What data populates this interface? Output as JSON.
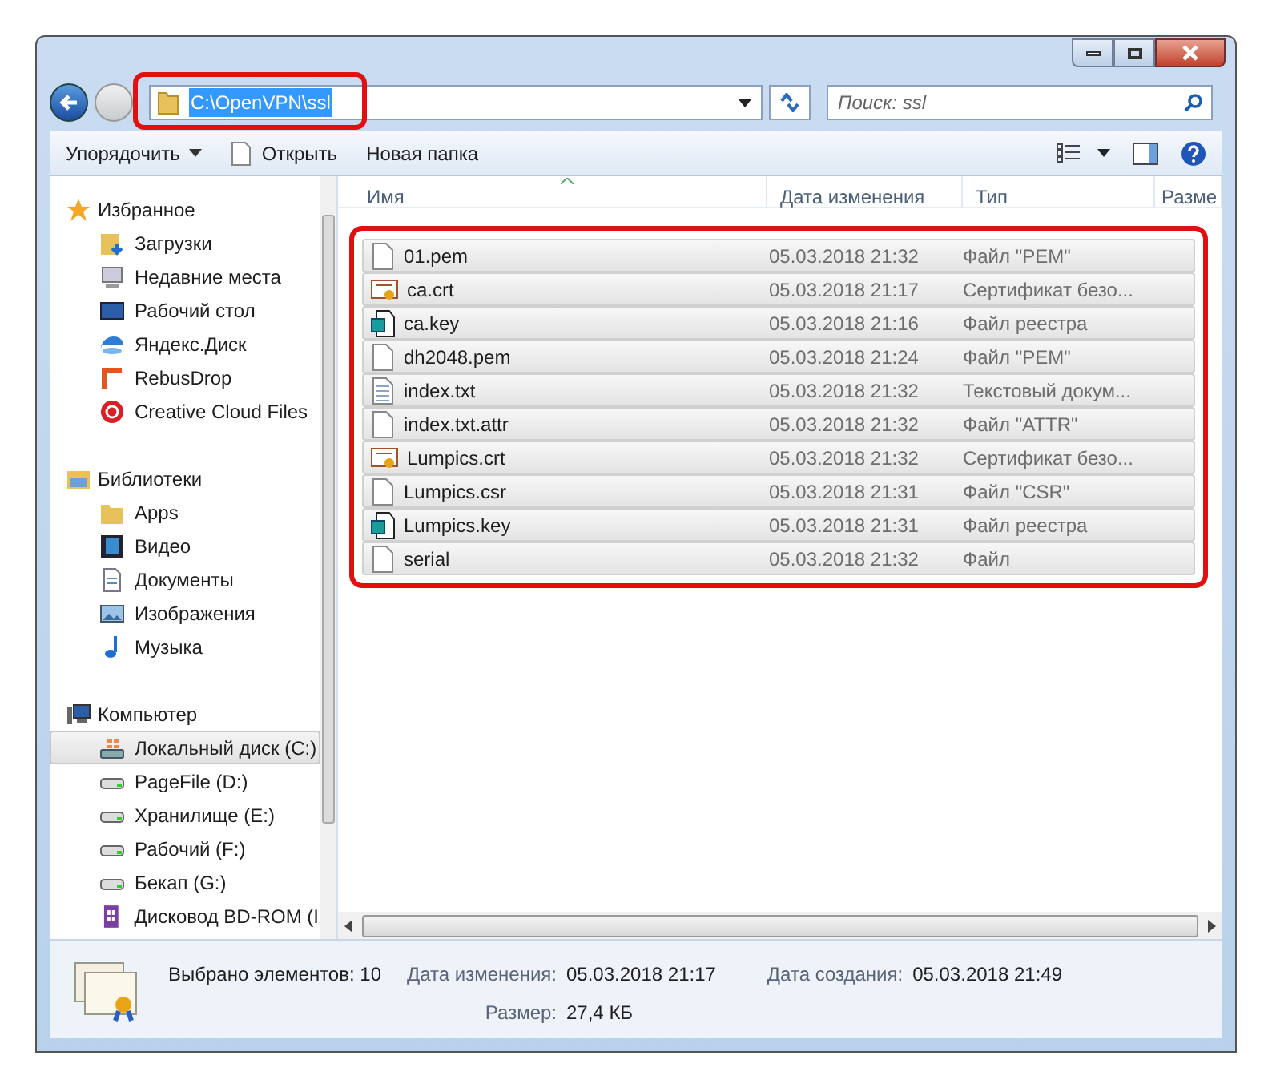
{
  "address": {
    "path": "C:\\OpenVPN\\ssl",
    "selected": true
  },
  "search": {
    "placeholder": "Поиск: ssl"
  },
  "toolbar": [
    "Упорядочить",
    "Открыть",
    "Новая папка"
  ],
  "nav": [
    {
      "label": "Избранное",
      "kind": "star",
      "children": [
        {
          "label": "Загрузки",
          "kind": "download",
          "selected": false
        },
        {
          "label": "Недавние места",
          "kind": "recent",
          "selected": false
        },
        {
          "label": "Рабочий стол",
          "kind": "desktop",
          "selected": false
        },
        {
          "label": "Яндекс.Диск",
          "kind": "cloud",
          "selected": false
        },
        {
          "label": "RebusDrop",
          "kind": "corner",
          "selected": false
        },
        {
          "label": "Creative Cloud Files",
          "kind": "cc",
          "selected": false
        }
      ]
    },
    {
      "label": "Библиотеки",
      "kind": "library",
      "children": [
        {
          "label": "Apps",
          "kind": "folder",
          "selected": false
        },
        {
          "label": "Видео",
          "kind": "film",
          "selected": false
        },
        {
          "label": "Документы",
          "kind": "doc",
          "selected": false
        },
        {
          "label": "Изображения",
          "kind": "image",
          "selected": false
        },
        {
          "label": "Музыка",
          "kind": "music",
          "selected": false
        }
      ]
    },
    {
      "label": "Компьютер",
      "kind": "computer",
      "children": [
        {
          "label": "Локальный диск (C:)",
          "kind": "sysdrive",
          "selected": true
        },
        {
          "label": "PageFile (D:)",
          "kind": "drive",
          "selected": false
        },
        {
          "label": "Хранилище (E:)",
          "kind": "drive",
          "selected": false
        },
        {
          "label": "Рабочий (F:)",
          "kind": "drive",
          "selected": false
        },
        {
          "label": "Бекап (G:)",
          "kind": "drive",
          "selected": false
        },
        {
          "label": "Дисковод BD-ROM (I",
          "kind": "optical",
          "selected": false
        }
      ]
    }
  ],
  "columns": [
    "Имя",
    "Дата изменения",
    "Тип",
    "Разме"
  ],
  "files": [
    {
      "name": "01.pem",
      "date": "05.03.2018 21:32",
      "type": "Файл \"PEM\"",
      "kind": "file",
      "selected": true
    },
    {
      "name": "ca.crt",
      "date": "05.03.2018 21:17",
      "type": "Сертификат безо...",
      "kind": "certificate",
      "selected": true
    },
    {
      "name": "ca.key",
      "date": "05.03.2018 21:16",
      "type": "Файл реестра",
      "kind": "registry",
      "selected": true
    },
    {
      "name": "dh2048.pem",
      "date": "05.03.2018 21:24",
      "type": "Файл \"PEM\"",
      "kind": "file",
      "selected": true
    },
    {
      "name": "index.txt",
      "date": "05.03.2018 21:32",
      "type": "Текстовый докум...",
      "kind": "text",
      "selected": true
    },
    {
      "name": "index.txt.attr",
      "date": "05.03.2018 21:32",
      "type": "Файл \"ATTR\"",
      "kind": "file",
      "selected": true
    },
    {
      "name": "Lumpics.crt",
      "date": "05.03.2018 21:32",
      "type": "Сертификат безо...",
      "kind": "certificate",
      "selected": true
    },
    {
      "name": "Lumpics.csr",
      "date": "05.03.2018 21:31",
      "type": "Файл \"CSR\"",
      "kind": "file",
      "selected": true
    },
    {
      "name": "Lumpics.key",
      "date": "05.03.2018 21:31",
      "type": "Файл реестра",
      "kind": "registry",
      "selected": true
    },
    {
      "name": "serial",
      "date": "05.03.2018 21:32",
      "type": "Файл",
      "kind": "file",
      "selected": true
    }
  ],
  "details": {
    "count": "Выбрано элементов: 10",
    "fields": [
      {
        "label": "Дата изменения:",
        "value": "05.03.2018 21:17"
      },
      {
        "label": "Дата создания:",
        "value": "05.03.2018 21:49"
      },
      {
        "label": "Размер:",
        "value": "27,4 КБ"
      }
    ]
  }
}
